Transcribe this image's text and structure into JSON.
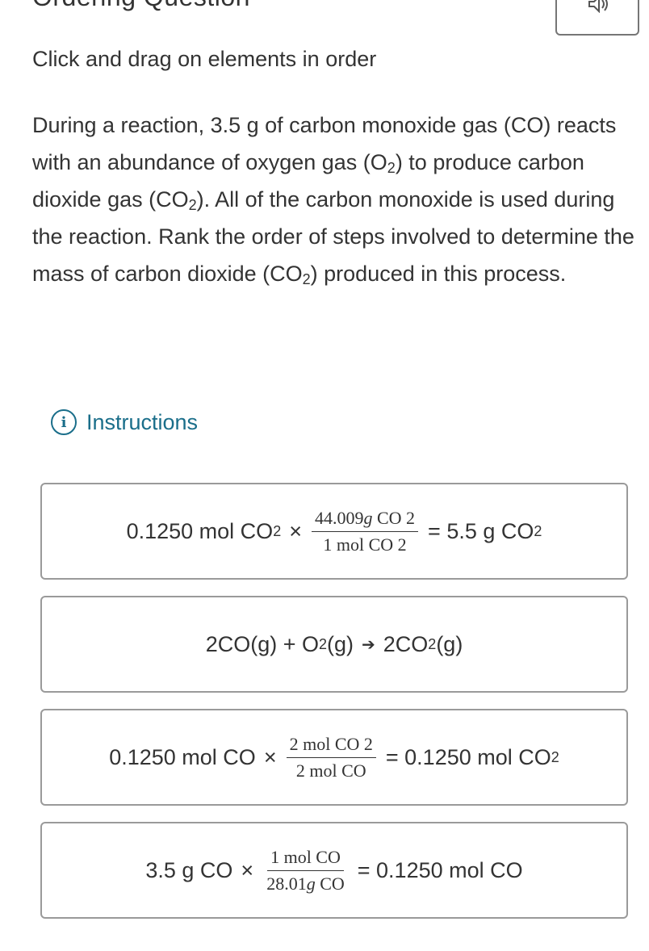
{
  "header": {
    "title": "Ordering Question",
    "audio_icon": "speaker-icon"
  },
  "question": {
    "subtitle": "Click and drag on elements in order",
    "prompt": {
      "p1": "During a reaction, 3.5 g of carbon monoxide gas (CO) reacts with an abundance of oxygen gas (O",
      "sub1": "2",
      "p2": ") to produce carbon dioxide gas (CO",
      "sub2": "2",
      "p3": "). All of the carbon monoxide is used during the reaction. Rank the order of steps involved to determine the mass of carbon dioxide (CO",
      "sub3": "2",
      "p4": ") produced in this process."
    },
    "instructions_label": "Instructions",
    "instructions_icon": "info-icon"
  },
  "cards": [
    {
      "lhs": "0.1250 mol CO",
      "lhs_sub": "2",
      "times": "×",
      "frac_num_val": "44.009",
      "frac_num_unit": "g",
      "frac_num_rest": " CO 2",
      "frac_den": "1 mol CO 2",
      "rhs": "= 5.5 g CO",
      "rhs_sub": "2"
    },
    {
      "eq_a": "2CO(g) + O",
      "eq_a_sub": "2",
      "eq_b": "(g)",
      "arrow": "➔",
      "eq_c": "2CO",
      "eq_c_sub": "2",
      "eq_d": "(g)"
    },
    {
      "lhs": "0.1250 mol CO",
      "times": "×",
      "frac_num": "2 mol CO 2",
      "frac_den": "2 mol CO",
      "rhs": "= 0.1250 mol CO",
      "rhs_sub": "2"
    },
    {
      "lhs": "3.5 g CO",
      "times": "×",
      "frac_num": "1 mol CO",
      "frac_den_val": "28.01",
      "frac_den_unit": "g",
      "frac_den_rest": " CO",
      "rhs": "= 0.1250 mol CO"
    }
  ]
}
